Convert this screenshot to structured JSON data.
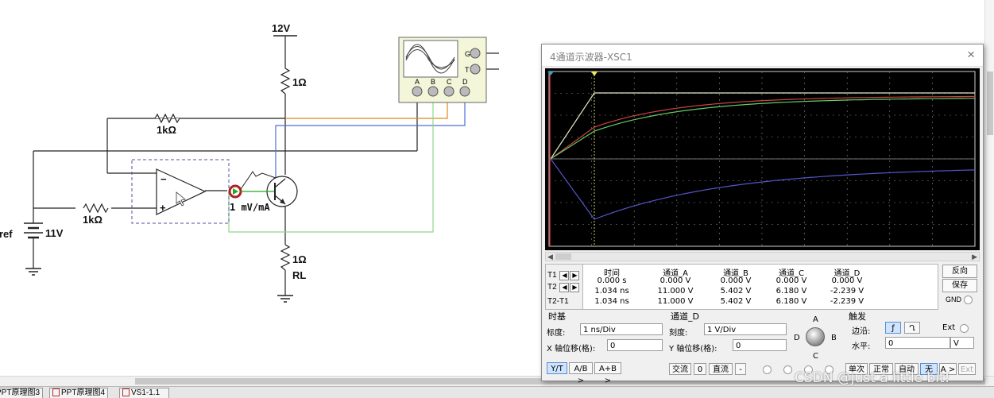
{
  "schematic": {
    "supply_label": "12V",
    "r_top_label": "1Ω",
    "r_feedback_label": "1kΩ",
    "r_input_label": "1kΩ",
    "source_label": "11V",
    "source_name_partial": "Vref",
    "r_load_label": "1Ω",
    "r_load_name": "RL",
    "probe_label": "1 mV/mA",
    "scope_terminals": [
      "A",
      "B",
      "C",
      "D"
    ],
    "scope_g": "G",
    "scope_t": "T",
    "wire_colors": {
      "a": "#000000",
      "b": "#4f6fd0",
      "c": "#e08a1a",
      "d": "#8cd88c"
    }
  },
  "oscilloscope": {
    "title": "4通道示波器-XSC1",
    "close_glyph": "×",
    "screen": {
      "background": "#000000",
      "trace_colors": {
        "A": "#e8e8c8",
        "B": "#cc4444",
        "C": "#66cc66",
        "D": "#5555cc"
      }
    },
    "cursor_rows": [
      "T1",
      "T2",
      "T2-T1"
    ],
    "measure_headers": [
      "时间",
      "通道_A",
      "通道_B",
      "通道_C",
      "通道_D"
    ],
    "measure_rows": [
      [
        "0.000 s",
        "0.000 V",
        "0.000 V",
        "0.000 V",
        "0.000 V"
      ],
      [
        "1.034 ns",
        "11.000 V",
        "5.402 V",
        "6.180 V",
        "-2.239 V"
      ],
      [
        "1.034 ns",
        "11.000 V",
        "5.402 V",
        "6.180 V",
        "-2.239 V"
      ]
    ],
    "side_buttons": {
      "reverse": "反向",
      "save": "保存",
      "gnd": "GND"
    },
    "timebase": {
      "title": "时基",
      "scale_label": "标度:",
      "scale_value": "1 ns/Div",
      "xpos_label": "X 轴位移(格):",
      "xpos_value": "0",
      "modes": [
        "Y/T",
        "A/B >",
        "A+B >"
      ]
    },
    "channel": {
      "title": "通道_D",
      "scale_label": "刻度:",
      "scale_value": "1  V/Div",
      "ypos_label": "Y 轴位移(格):",
      "ypos_value": "0",
      "coupling": [
        "交流",
        "0",
        "直流",
        "-"
      ],
      "knob_labels": {
        "a": "A",
        "b": "B",
        "c": "C",
        "d": "D"
      }
    },
    "trigger": {
      "title": "触发",
      "edge_label": "边沿:",
      "edge_rise": "ƒ",
      "edge_fall": "Ղ",
      "ext_label": "Ext",
      "level_label": "水平:",
      "level_value": "0",
      "level_unit": "V",
      "modes": [
        "单次",
        "正常",
        "自动",
        "无",
        "A >",
        "Ext"
      ]
    }
  },
  "tabs": [
    "PPT原理图3",
    "PPT原理图4",
    "VS1-1.1"
  ],
  "watermark": "CSDN @just a little bit!"
}
